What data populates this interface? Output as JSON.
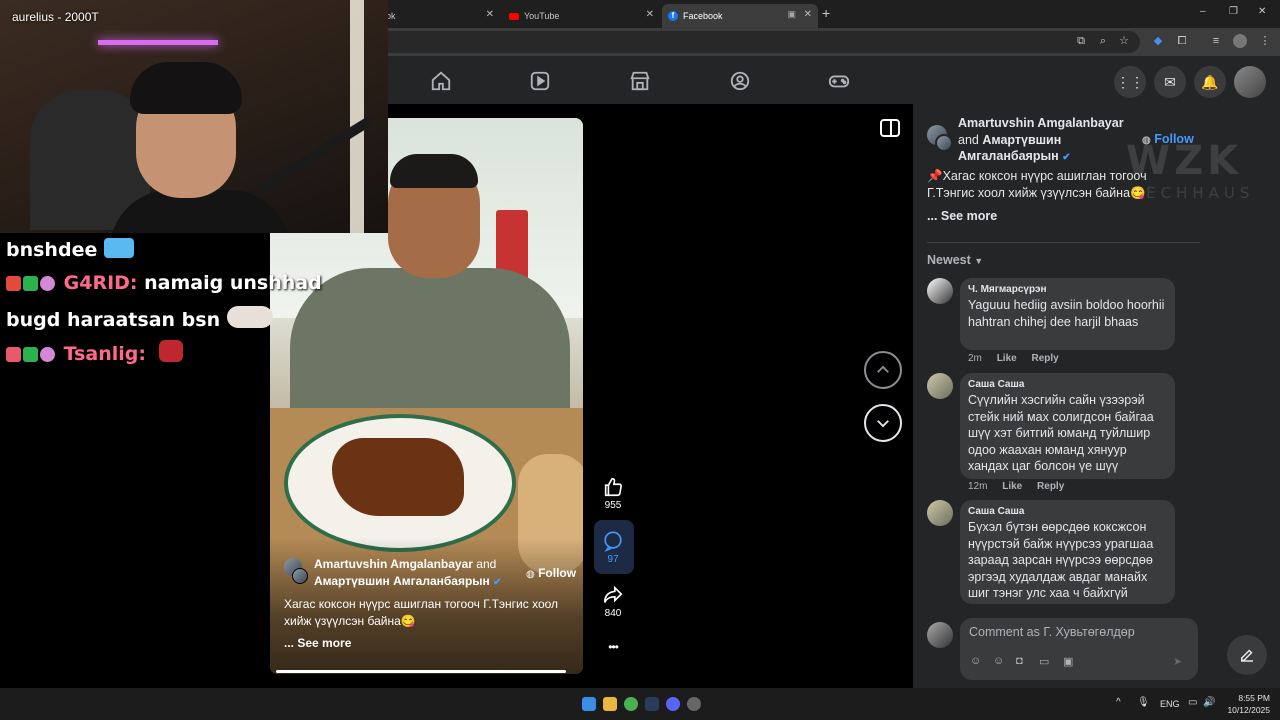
{
  "browser": {
    "tabs": [
      {
        "label": "ok"
      },
      {
        "label": "YouTube"
      },
      {
        "label": "Facebook",
        "active": true
      }
    ],
    "new_tab": "+",
    "window_controls": [
      "–",
      "❐",
      "✕"
    ]
  },
  "webcam": {
    "username": "aurelius - 2000T"
  },
  "chat": [
    {
      "user": "bnshdee",
      "message": ""
    },
    {
      "user": "G4RID:",
      "message": "namaig unshhad"
    },
    {
      "user": "",
      "message": "bugd haraatsan bsn"
    },
    {
      "user": "Tsanlig:",
      "message": ""
    }
  ],
  "reel": {
    "author_line1": "Amartuvshin Amgalanbayar",
    "author_and": "and",
    "author_line2": "Амартүвшин Амгаланбаярын",
    "follow": "Follow",
    "caption": "Хагас коксон нүүрс ашиглан тогооч Г.Тэнгис хоол хийж үзүүлсэн байна😋",
    "see_more": "... See more",
    "likes": "955",
    "comments": "97",
    "shares": "840",
    "more": "•••"
  },
  "panel": {
    "author_line1": "Amartuvshin Amgalanbayar",
    "author_and": "and",
    "author_line2a": "Амартүвшин",
    "author_line2b": "Амгаланбаярын",
    "follow": "Follow",
    "caption": "📌Хагас коксон нүүрс ашиглан тогооч Г.Тэнгис хоол хийж үзүүлсэн байна😋",
    "see_more": "... See more",
    "sort": "Newest",
    "comments": [
      {
        "name": "Ч. Мягмарсүрэн",
        "text": "Yaguuu hediig avsiin boldoo hoorhii hahtran chihej dee harjil bhaas",
        "time": "2m",
        "like": "Like",
        "reply": "Reply"
      },
      {
        "name": "Саша Саша",
        "text": "Сүүлийн хэсгийн сайн үзээрэй стейк ний мах солигдсон байгаа шүү хэт битгий юманд туйлшир одоо жаахан юманд хянуур хандах цаг болсон үе шүү",
        "time": "12m",
        "like": "Like",
        "reply": "Reply"
      },
      {
        "name": "Саша Саша",
        "text": "Бүхэл бүтэн өөрсдөө коксжсон нүүрстэй байж нүүрсээ урагшаа зараад зарсан нүүрсээ өөрсдөө эргээд худалдаж авдаг манайх шиг тэнэг улс хаа ч байхгүй тэгээд",
        "time": "",
        "like": "",
        "reply": ""
      }
    ],
    "comment_placeholder": "Comment as Г. Хувьтөгөлдөр"
  },
  "watermark": {
    "line1": "WZK",
    "line2": "TECHHAUS"
  },
  "taskbar": {
    "lang": "ENG",
    "time": "8:55 PM",
    "date": "10/12/2025"
  },
  "colors": {
    "accent": "#1877f2",
    "follow": "#4599ff",
    "panel": "#242526",
    "bubble": "#3a3b3c"
  }
}
